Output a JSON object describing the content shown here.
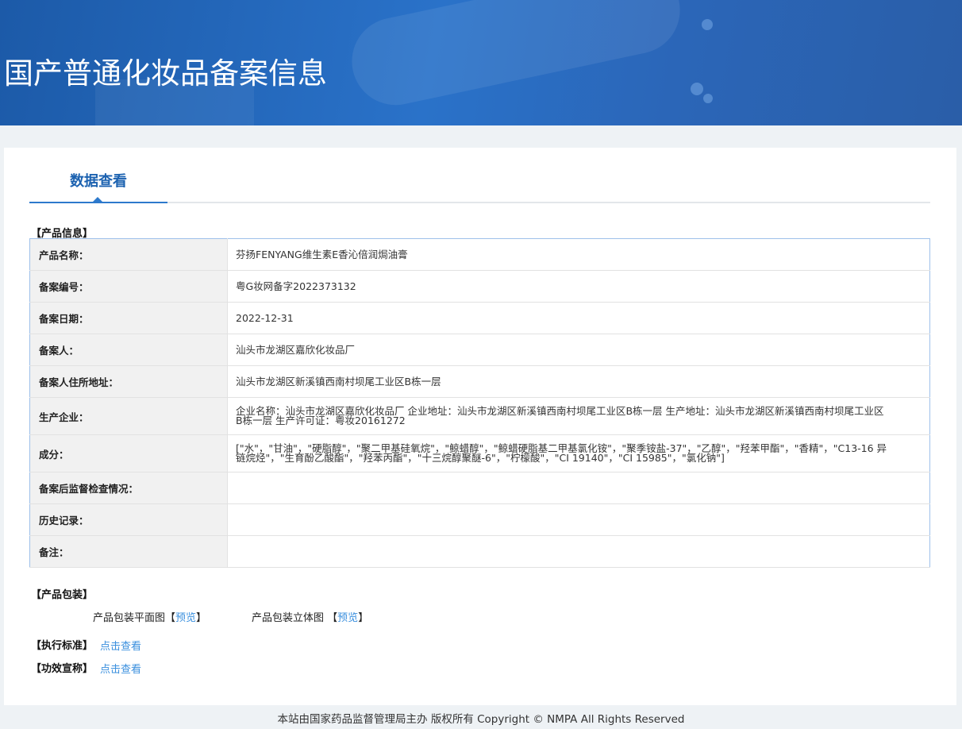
{
  "header": {
    "title": "国产普通化妆品备案信息"
  },
  "tabs": [
    {
      "label": "数据查看",
      "active": true
    }
  ],
  "product_info": {
    "section_title": "【产品信息】",
    "rows": [
      {
        "label": "产品名称：",
        "value": "芬扬FENYANG维生素E香沁倍润焗油膏"
      },
      {
        "label": "备案编号：",
        "value": "粤G妆网备字2022373132"
      },
      {
        "label": "备案日期：",
        "value": "2022-12-31"
      },
      {
        "label": "备案人：",
        "value": "汕头市龙湖区嘉欣化妆品厂"
      },
      {
        "label": "备案人住所地址：",
        "value": "汕头市龙湖区新溪镇西南村坝尾工业区B栋一层"
      },
      {
        "label": "生产企业：",
        "value": "企业名称：汕头市龙湖区嘉欣化妆品厂 企业地址：汕头市龙湖区新溪镇西南村坝尾工业区B栋一层 生产地址：汕头市龙湖区新溪镇西南村坝尾工业区B栋一层 生产许可证：粤妆20161272"
      },
      {
        "label": "成分：",
        "value": "[\"水\"，\"甘油\"，\"硬脂醇\"，\"聚二甲基硅氧烷\"，\"鲸蜡醇\"，\"鲸蜡硬脂基二甲基氯化铵\"，\"聚季铵盐-37\"，\"乙醇\"，\"羟苯甲酯\"，\"香精\"，\"C13-16 异链烷烃\"，\"生育酚乙酸酯\"，\"羟苯丙酯\"，\"十三烷醇聚醚-6\"，\"柠檬酸\"，\"CI 19140\"，\"CI 15985\"，\"氯化钠\"]"
      },
      {
        "label": "备案后监督检查情况：",
        "value": ""
      },
      {
        "label": "历史记录：",
        "value": ""
      },
      {
        "label": "备注：",
        "value": ""
      }
    ]
  },
  "packaging": {
    "section_title": "【产品包装】",
    "flat_label": "产品包装平面图",
    "stereo_label": "产品包装立体图",
    "bracket_open": "【",
    "bracket_close": "】",
    "preview_link": "预览"
  },
  "standard": {
    "label": "【执行标准】",
    "link": "点击查看"
  },
  "claims": {
    "label": "【功效宣称】",
    "link": "点击查看"
  },
  "footer": {
    "text": "本站由国家药品监督管理局主办 版权所有 Copyright © NMPA All Rights Reserved"
  }
}
